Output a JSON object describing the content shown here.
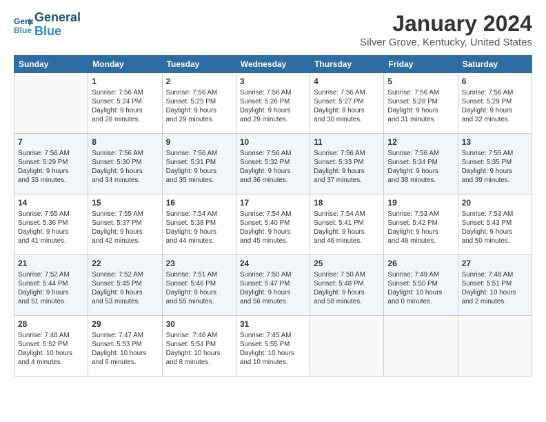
{
  "header": {
    "logo_line1": "General",
    "logo_line2": "Blue",
    "month": "January 2024",
    "location": "Silver Grove, Kentucky, United States"
  },
  "weekdays": [
    "Sunday",
    "Monday",
    "Tuesday",
    "Wednesday",
    "Thursday",
    "Friday",
    "Saturday"
  ],
  "weeks": [
    [
      {
        "day": "",
        "info": ""
      },
      {
        "day": "1",
        "info": "Sunrise: 7:56 AM\nSunset: 5:24 PM\nDaylight: 9 hours\nand 28 minutes."
      },
      {
        "day": "2",
        "info": "Sunrise: 7:56 AM\nSunset: 5:25 PM\nDaylight: 9 hours\nand 29 minutes."
      },
      {
        "day": "3",
        "info": "Sunrise: 7:56 AM\nSunset: 5:26 PM\nDaylight: 9 hours\nand 29 minutes."
      },
      {
        "day": "4",
        "info": "Sunrise: 7:56 AM\nSunset: 5:27 PM\nDaylight: 9 hours\nand 30 minutes."
      },
      {
        "day": "5",
        "info": "Sunrise: 7:56 AM\nSunset: 5:28 PM\nDaylight: 9 hours\nand 31 minutes."
      },
      {
        "day": "6",
        "info": "Sunrise: 7:56 AM\nSunset: 5:29 PM\nDaylight: 9 hours\nand 32 minutes."
      }
    ],
    [
      {
        "day": "7",
        "info": "Sunrise: 7:56 AM\nSunset: 5:29 PM\nDaylight: 9 hours\nand 33 minutes."
      },
      {
        "day": "8",
        "info": "Sunrise: 7:56 AM\nSunset: 5:30 PM\nDaylight: 9 hours\nand 34 minutes."
      },
      {
        "day": "9",
        "info": "Sunrise: 7:56 AM\nSunset: 5:31 PM\nDaylight: 9 hours\nand 35 minutes."
      },
      {
        "day": "10",
        "info": "Sunrise: 7:56 AM\nSunset: 5:32 PM\nDaylight: 9 hours\nand 36 minutes."
      },
      {
        "day": "11",
        "info": "Sunrise: 7:56 AM\nSunset: 5:33 PM\nDaylight: 9 hours\nand 37 minutes."
      },
      {
        "day": "12",
        "info": "Sunrise: 7:56 AM\nSunset: 5:34 PM\nDaylight: 9 hours\nand 38 minutes."
      },
      {
        "day": "13",
        "info": "Sunrise: 7:55 AM\nSunset: 5:35 PM\nDaylight: 9 hours\nand 39 minutes."
      }
    ],
    [
      {
        "day": "14",
        "info": "Sunrise: 7:55 AM\nSunset: 5:36 PM\nDaylight: 9 hours\nand 41 minutes."
      },
      {
        "day": "15",
        "info": "Sunrise: 7:55 AM\nSunset: 5:37 PM\nDaylight: 9 hours\nand 42 minutes."
      },
      {
        "day": "16",
        "info": "Sunrise: 7:54 AM\nSunset: 5:38 PM\nDaylight: 9 hours\nand 44 minutes."
      },
      {
        "day": "17",
        "info": "Sunrise: 7:54 AM\nSunset: 5:40 PM\nDaylight: 9 hours\nand 45 minutes."
      },
      {
        "day": "18",
        "info": "Sunrise: 7:54 AM\nSunset: 5:41 PM\nDaylight: 9 hours\nand 46 minutes."
      },
      {
        "day": "19",
        "info": "Sunrise: 7:53 AM\nSunset: 5:42 PM\nDaylight: 9 hours\nand 48 minutes."
      },
      {
        "day": "20",
        "info": "Sunrise: 7:53 AM\nSunset: 5:43 PM\nDaylight: 9 hours\nand 50 minutes."
      }
    ],
    [
      {
        "day": "21",
        "info": "Sunrise: 7:52 AM\nSunset: 5:44 PM\nDaylight: 9 hours\nand 51 minutes."
      },
      {
        "day": "22",
        "info": "Sunrise: 7:52 AM\nSunset: 5:45 PM\nDaylight: 9 hours\nand 53 minutes."
      },
      {
        "day": "23",
        "info": "Sunrise: 7:51 AM\nSunset: 5:46 PM\nDaylight: 9 hours\nand 55 minutes."
      },
      {
        "day": "24",
        "info": "Sunrise: 7:50 AM\nSunset: 5:47 PM\nDaylight: 9 hours\nand 56 minutes."
      },
      {
        "day": "25",
        "info": "Sunrise: 7:50 AM\nSunset: 5:48 PM\nDaylight: 9 hours\nand 58 minutes."
      },
      {
        "day": "26",
        "info": "Sunrise: 7:49 AM\nSunset: 5:50 PM\nDaylight: 10 hours\nand 0 minutes."
      },
      {
        "day": "27",
        "info": "Sunrise: 7:48 AM\nSunset: 5:51 PM\nDaylight: 10 hours\nand 2 minutes."
      }
    ],
    [
      {
        "day": "28",
        "info": "Sunrise: 7:48 AM\nSunset: 5:52 PM\nDaylight: 10 hours\nand 4 minutes."
      },
      {
        "day": "29",
        "info": "Sunrise: 7:47 AM\nSunset: 5:53 PM\nDaylight: 10 hours\nand 6 minutes."
      },
      {
        "day": "30",
        "info": "Sunrise: 7:46 AM\nSunset: 5:54 PM\nDaylight: 10 hours\nand 8 minutes."
      },
      {
        "day": "31",
        "info": "Sunrise: 7:45 AM\nSunset: 5:55 PM\nDaylight: 10 hours\nand 10 minutes."
      },
      {
        "day": "",
        "info": ""
      },
      {
        "day": "",
        "info": ""
      },
      {
        "day": "",
        "info": ""
      }
    ]
  ]
}
